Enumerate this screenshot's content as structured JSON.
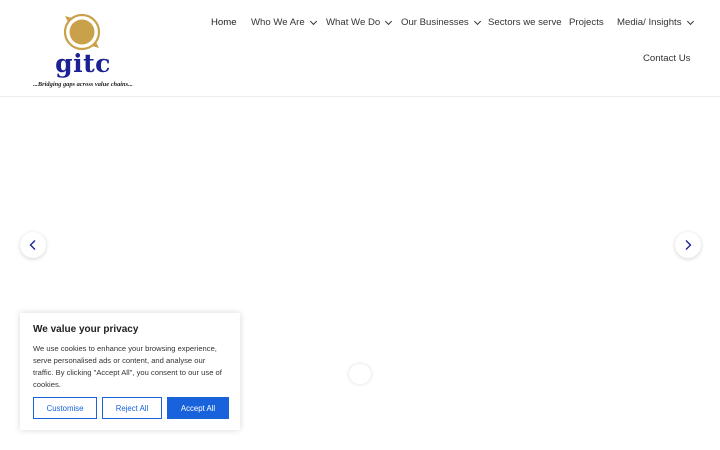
{
  "brand": {
    "name": "gitc",
    "tagline": "...Bridging gaps across value chains...",
    "colors": {
      "primary": "#1d2196",
      "gold": "#c9a14a",
      "accent": "#1863dc"
    }
  },
  "nav": {
    "items": [
      {
        "label": "Home",
        "dropdown": false,
        "active": true
      },
      {
        "label": "Who We Are",
        "dropdown": true
      },
      {
        "label": "What We Do",
        "dropdown": true
      },
      {
        "label": "Our Businesses",
        "dropdown": true
      },
      {
        "label": "Sectors we serve",
        "dropdown": false
      },
      {
        "label": "Projects",
        "dropdown": false
      },
      {
        "label": "Media/ Insights",
        "dropdown": true
      },
      {
        "label": "Contact Us",
        "dropdown": false
      }
    ]
  },
  "slider": {
    "prev_icon": "chevron-left-icon",
    "next_icon": "chevron-right-icon"
  },
  "cookie": {
    "title": "We value your privacy",
    "text": "We use cookies to enhance your browsing experience, serve personalised ads or content, and analyse our traffic. By clicking \"Accept All\", you consent to our use of cookies.",
    "customise": "Customise",
    "reject": "Reject All",
    "accept": "Accept All"
  }
}
